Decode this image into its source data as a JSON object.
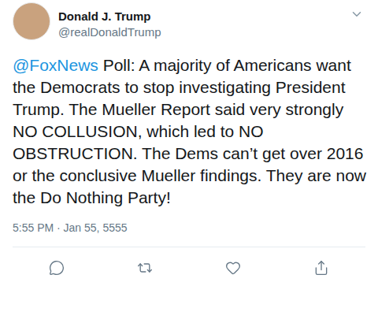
{
  "tweet": {
    "author": {
      "name": "Donald J. Trump",
      "handle": "@realDonaldTrump"
    },
    "body": [
      {
        "kind": "mention",
        "text": "@FoxNews"
      },
      {
        "kind": "plain",
        "text": " Poll: A majority of Americans want the Democrats to stop investigating President Trump. The Mueller Report said very strongly NO COLLUSION, which led to NO OBSTRUCTION. The Dems can’t get over 2016 or the conclusive Mueller findings. They are now the Do Nothing Party!"
      }
    ],
    "timestamp": "5:55 PM · Jan 55, 5555",
    "actions": [
      "reply",
      "retweet",
      "like",
      "share"
    ]
  }
}
